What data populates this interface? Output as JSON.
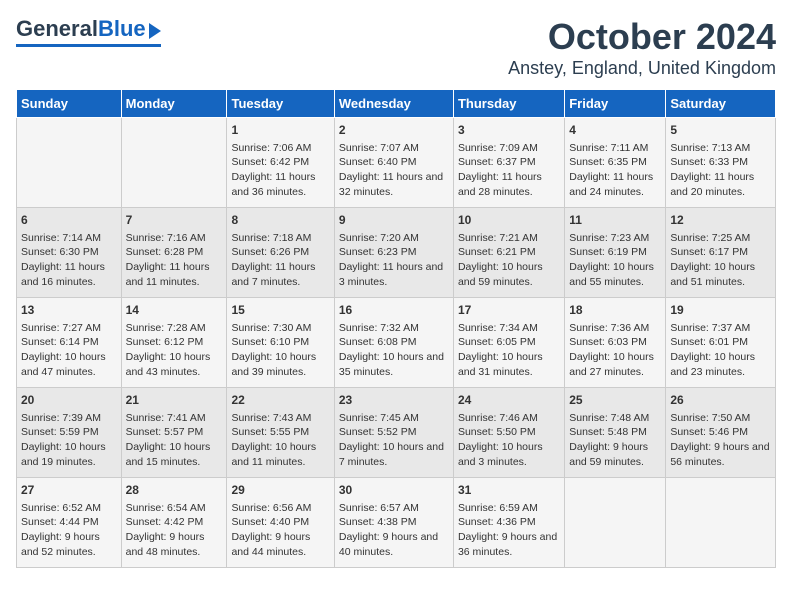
{
  "logo": {
    "general": "General",
    "blue": "Blue"
  },
  "title": "October 2024",
  "subtitle": "Anstey, England, United Kingdom",
  "days_of_week": [
    "Sunday",
    "Monday",
    "Tuesday",
    "Wednesday",
    "Thursday",
    "Friday",
    "Saturday"
  ],
  "weeks": [
    [
      {
        "day": "",
        "content": ""
      },
      {
        "day": "",
        "content": ""
      },
      {
        "day": "1",
        "content": "Sunrise: 7:06 AM\nSunset: 6:42 PM\nDaylight: 11 hours and 36 minutes."
      },
      {
        "day": "2",
        "content": "Sunrise: 7:07 AM\nSunset: 6:40 PM\nDaylight: 11 hours and 32 minutes."
      },
      {
        "day": "3",
        "content": "Sunrise: 7:09 AM\nSunset: 6:37 PM\nDaylight: 11 hours and 28 minutes."
      },
      {
        "day": "4",
        "content": "Sunrise: 7:11 AM\nSunset: 6:35 PM\nDaylight: 11 hours and 24 minutes."
      },
      {
        "day": "5",
        "content": "Sunrise: 7:13 AM\nSunset: 6:33 PM\nDaylight: 11 hours and 20 minutes."
      }
    ],
    [
      {
        "day": "6",
        "content": "Sunrise: 7:14 AM\nSunset: 6:30 PM\nDaylight: 11 hours and 16 minutes."
      },
      {
        "day": "7",
        "content": "Sunrise: 7:16 AM\nSunset: 6:28 PM\nDaylight: 11 hours and 11 minutes."
      },
      {
        "day": "8",
        "content": "Sunrise: 7:18 AM\nSunset: 6:26 PM\nDaylight: 11 hours and 7 minutes."
      },
      {
        "day": "9",
        "content": "Sunrise: 7:20 AM\nSunset: 6:23 PM\nDaylight: 11 hours and 3 minutes."
      },
      {
        "day": "10",
        "content": "Sunrise: 7:21 AM\nSunset: 6:21 PM\nDaylight: 10 hours and 59 minutes."
      },
      {
        "day": "11",
        "content": "Sunrise: 7:23 AM\nSunset: 6:19 PM\nDaylight: 10 hours and 55 minutes."
      },
      {
        "day": "12",
        "content": "Sunrise: 7:25 AM\nSunset: 6:17 PM\nDaylight: 10 hours and 51 minutes."
      }
    ],
    [
      {
        "day": "13",
        "content": "Sunrise: 7:27 AM\nSunset: 6:14 PM\nDaylight: 10 hours and 47 minutes."
      },
      {
        "day": "14",
        "content": "Sunrise: 7:28 AM\nSunset: 6:12 PM\nDaylight: 10 hours and 43 minutes."
      },
      {
        "day": "15",
        "content": "Sunrise: 7:30 AM\nSunset: 6:10 PM\nDaylight: 10 hours and 39 minutes."
      },
      {
        "day": "16",
        "content": "Sunrise: 7:32 AM\nSunset: 6:08 PM\nDaylight: 10 hours and 35 minutes."
      },
      {
        "day": "17",
        "content": "Sunrise: 7:34 AM\nSunset: 6:05 PM\nDaylight: 10 hours and 31 minutes."
      },
      {
        "day": "18",
        "content": "Sunrise: 7:36 AM\nSunset: 6:03 PM\nDaylight: 10 hours and 27 minutes."
      },
      {
        "day": "19",
        "content": "Sunrise: 7:37 AM\nSunset: 6:01 PM\nDaylight: 10 hours and 23 minutes."
      }
    ],
    [
      {
        "day": "20",
        "content": "Sunrise: 7:39 AM\nSunset: 5:59 PM\nDaylight: 10 hours and 19 minutes."
      },
      {
        "day": "21",
        "content": "Sunrise: 7:41 AM\nSunset: 5:57 PM\nDaylight: 10 hours and 15 minutes."
      },
      {
        "day": "22",
        "content": "Sunrise: 7:43 AM\nSunset: 5:55 PM\nDaylight: 10 hours and 11 minutes."
      },
      {
        "day": "23",
        "content": "Sunrise: 7:45 AM\nSunset: 5:52 PM\nDaylight: 10 hours and 7 minutes."
      },
      {
        "day": "24",
        "content": "Sunrise: 7:46 AM\nSunset: 5:50 PM\nDaylight: 10 hours and 3 minutes."
      },
      {
        "day": "25",
        "content": "Sunrise: 7:48 AM\nSunset: 5:48 PM\nDaylight: 9 hours and 59 minutes."
      },
      {
        "day": "26",
        "content": "Sunrise: 7:50 AM\nSunset: 5:46 PM\nDaylight: 9 hours and 56 minutes."
      }
    ],
    [
      {
        "day": "27",
        "content": "Sunrise: 6:52 AM\nSunset: 4:44 PM\nDaylight: 9 hours and 52 minutes."
      },
      {
        "day": "28",
        "content": "Sunrise: 6:54 AM\nSunset: 4:42 PM\nDaylight: 9 hours and 48 minutes."
      },
      {
        "day": "29",
        "content": "Sunrise: 6:56 AM\nSunset: 4:40 PM\nDaylight: 9 hours and 44 minutes."
      },
      {
        "day": "30",
        "content": "Sunrise: 6:57 AM\nSunset: 4:38 PM\nDaylight: 9 hours and 40 minutes."
      },
      {
        "day": "31",
        "content": "Sunrise: 6:59 AM\nSunset: 4:36 PM\nDaylight: 9 hours and 36 minutes."
      },
      {
        "day": "",
        "content": ""
      },
      {
        "day": "",
        "content": ""
      }
    ]
  ]
}
